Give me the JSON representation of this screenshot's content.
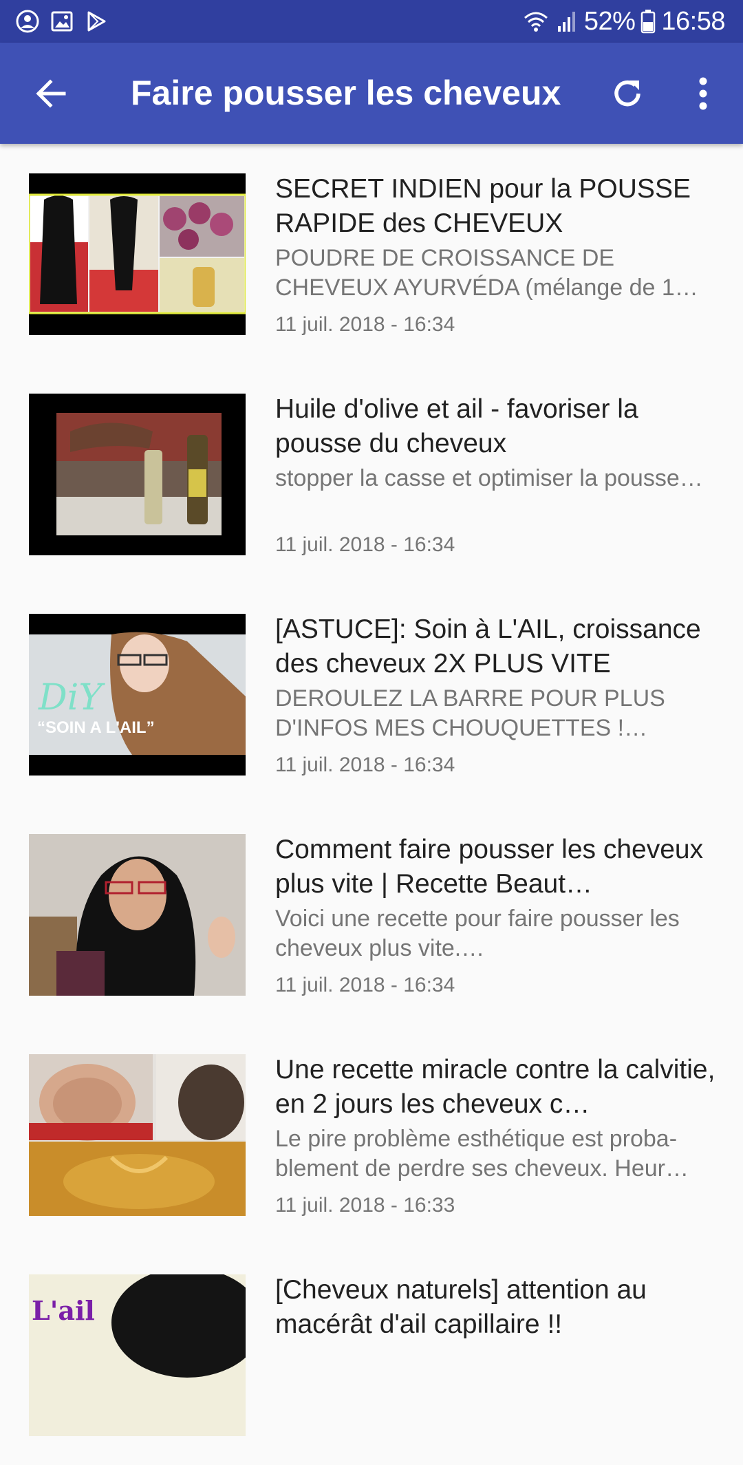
{
  "status_bar": {
    "battery_percent": "52%",
    "time": "16:58",
    "left_icons": [
      "account-circle-icon",
      "image-icon",
      "play-store-icon"
    ],
    "right_icons": [
      "wifi-icon",
      "signal-icon",
      "battery-icon"
    ]
  },
  "app_bar": {
    "title": "Faire pousser les cheveux",
    "color": "#3f51b5",
    "status_color": "#303f9f",
    "icons": [
      "back-arrow-icon",
      "refresh-icon",
      "more-vert-icon"
    ]
  },
  "videos": [
    {
      "title": "SECRET INDIEN pour la POUSSE RAPIDE des CHEVEUX",
      "description": "POUDRE DE CROISSANCE DE CHEVEUX AYURVÉDA (mélange de 1…",
      "date": "11 juil. 2018 - 16:34"
    },
    {
      "title": "Huile d'olive et ail - favoriser la pousse du cheveux",
      "description": "stopper la casse et optimiser la pousse…",
      "date": "11 juil. 2018 - 16:34"
    },
    {
      "title": "[ASTUCE]: Soin à L'AIL, croissance des cheveux 2X PLUS VITE",
      "description": "DEROULEZ LA BARRE POUR PLUS D'INFOS MES CHOUQUETTES !…",
      "date": "11 juil. 2018 - 16:34",
      "thumb_caption_1": "DiY",
      "thumb_caption_2": "“SOIN A L'AIL”"
    },
    {
      "title": "Comment faire pousser les cheveux plus vite | Recette Beaut…",
      "description": "Voici une recette pour faire pousser les cheveux plus vite.…",
      "date": "11 juil. 2018 - 16:34"
    },
    {
      "title": "Une recette miracle contre la calvitie, en 2 jours les cheveux c…",
      "description": "Le pire problème esthétique est proba- blement de perdre ses cheveux. Heur…",
      "date": "11 juil. 2018 - 16:33"
    },
    {
      "title": "[Cheveux naturels] attention au macérât d'ail capillaire !!",
      "thumb_caption": "L'ail"
    }
  ]
}
